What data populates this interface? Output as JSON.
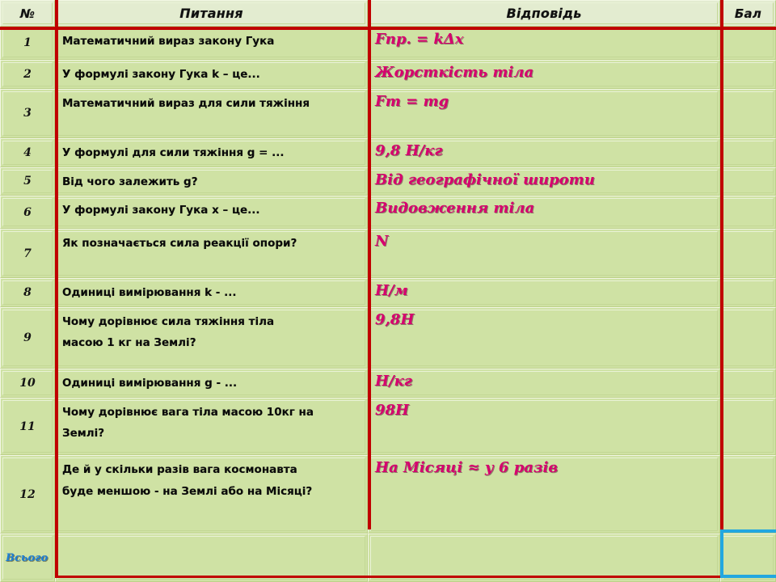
{
  "header": {
    "num": "№",
    "question": "Питання",
    "answer": "Відповідь",
    "score": "Бал"
  },
  "colors": {
    "page_background": "#ccdf9e",
    "cell_face": "#cfe2a4",
    "header_face": "#e3ecd0",
    "rule_red": "#c00000",
    "answer_text": "#d6006e",
    "total_text": "#1f7fd4",
    "total_box_border": "#22a7e0"
  },
  "rows": [
    {
      "num": "1",
      "question_lines": [
        "Математичний вираз закону  Гука"
      ],
      "answer": "Fпр. =  kΔx",
      "score": ""
    },
    {
      "num": "2",
      "question_lines": [
        "У формулі закону Гука k – це..."
      ],
      "answer": "Жорсткість тіла",
      "score": ""
    },
    {
      "num": "3",
      "question_lines": [
        "Математичний  вираз  для сили тяжіння"
      ],
      "answer": "Fт = mg",
      "score": ""
    },
    {
      "num": "4",
      "question_lines": [
        "У формулі для сили тяжіння g = ..."
      ],
      "answer": "9,8 Н/кг",
      "score": ""
    },
    {
      "num": "5",
      "question_lines": [
        "Від чого залежить g?"
      ],
      "answer": "Від географічної широти",
      "score": ""
    },
    {
      "num": "6",
      "question_lines": [
        "У формулі закону  Гука х – це..."
      ],
      "answer": "Видовження тіла",
      "score": ""
    },
    {
      "num": "7",
      "question_lines": [
        "Як позначається  сила реакції опори?"
      ],
      "answer": "N",
      "score": ""
    },
    {
      "num": "8",
      "question_lines": [
        "Одиниці вимірювання  k - ..."
      ],
      "answer": "Н/м",
      "score": ""
    },
    {
      "num": "9",
      "question_lines": [
        "Чому дорівнює сила тяжіння тіла",
        "масою 1 кг на Землі?"
      ],
      "answer": "9,8Н",
      "score": ""
    },
    {
      "num": "10",
      "question_lines": [
        "Одиниці вимірювання  g - ..."
      ],
      "answer": "Н/кг",
      "score": ""
    },
    {
      "num": "11",
      "question_lines": [
        "Чому дорівнює  вага тіла масою 10кг на",
        "Землі?"
      ],
      "answer": "98Н",
      "score": ""
    },
    {
      "num": "12",
      "question_lines": [
        "Де й у скільки  разів  вага космонавта",
        "буде меншою - на Землі або на Місяці?"
      ],
      "answer": "На Місяці  ≈ у 6 разів",
      "score": ""
    }
  ],
  "totals": {
    "label": "Всього",
    "question": "",
    "answer": "",
    "score": ""
  }
}
